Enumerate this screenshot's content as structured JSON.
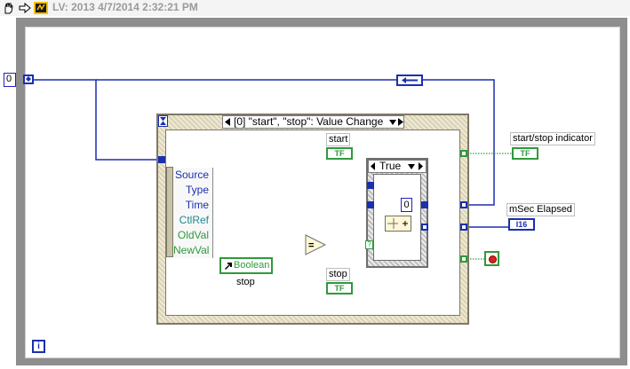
{
  "window": {
    "title": "LV: 2013 4/7/2014 2:32:21 PM"
  },
  "toolbar": {
    "icons": [
      "hand-icon",
      "arrow-right-icon",
      "labview-logo-icon"
    ]
  },
  "diagram": {
    "loop_iteration_terminal": "i",
    "loop_count_constant": "0",
    "event_structure": {
      "case_label": "[0] \"start\", \"stop\": Value Change",
      "hourglass_icon": "hourglass-icon",
      "event_data_node": [
        "Source",
        "Type",
        "Time",
        "CtlRef",
        "OldVal",
        "NewVal"
      ]
    },
    "case_structure": {
      "selector_value": "True"
    },
    "inner_constant": "0",
    "controls": {
      "start_label": "start",
      "start_terminal": "TF",
      "stop_label": "stop",
      "stop_terminal": "TF"
    },
    "indicators": {
      "start_stop_label": "start/stop indicator",
      "start_stop_terminal": "TF",
      "msec_label": "mSec Elapsed",
      "msec_terminal": "I16"
    },
    "boolean_ref": {
      "label": "Boolean",
      "caption": "stop"
    }
  },
  "colors": {
    "frame": "#8e8e8e",
    "wire_blue": "#1a2fb0",
    "wire_green": "#2e9a3c",
    "wire_teal": "#1f8a8a",
    "struct_frame": "#c8c2a8"
  }
}
